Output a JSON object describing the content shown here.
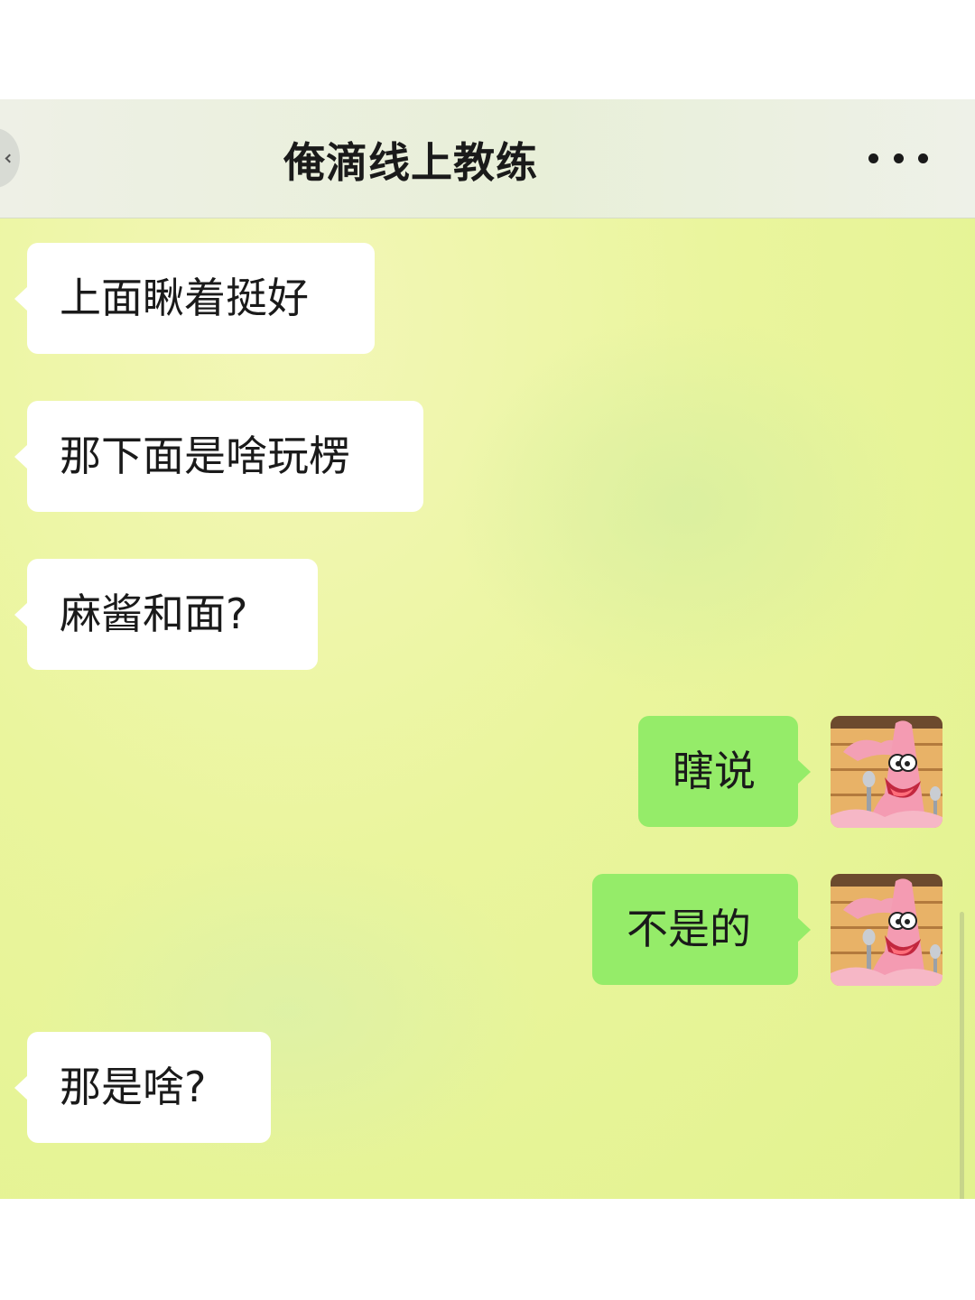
{
  "header": {
    "title": "俺滴线上教练",
    "back_icon": "chevron-left-icon",
    "more_icon": "more-dots-icon"
  },
  "messages": [
    {
      "side": "in",
      "text": "上面瞅着挺好"
    },
    {
      "side": "in",
      "text": "那下面是啥玩楞"
    },
    {
      "side": "in",
      "text": "麻酱和面?"
    },
    {
      "side": "out",
      "text": "瞎说",
      "avatar": "patrick-star-avatar"
    },
    {
      "side": "out",
      "text": "不是的",
      "avatar": "patrick-star-avatar"
    },
    {
      "side": "in",
      "text": "那是啥?"
    }
  ],
  "colors": {
    "chat_background": "#eaf59d",
    "incoming_bubble": "#ffffff",
    "outgoing_bubble": "#95ec69",
    "header_background": "#eef0e6"
  }
}
